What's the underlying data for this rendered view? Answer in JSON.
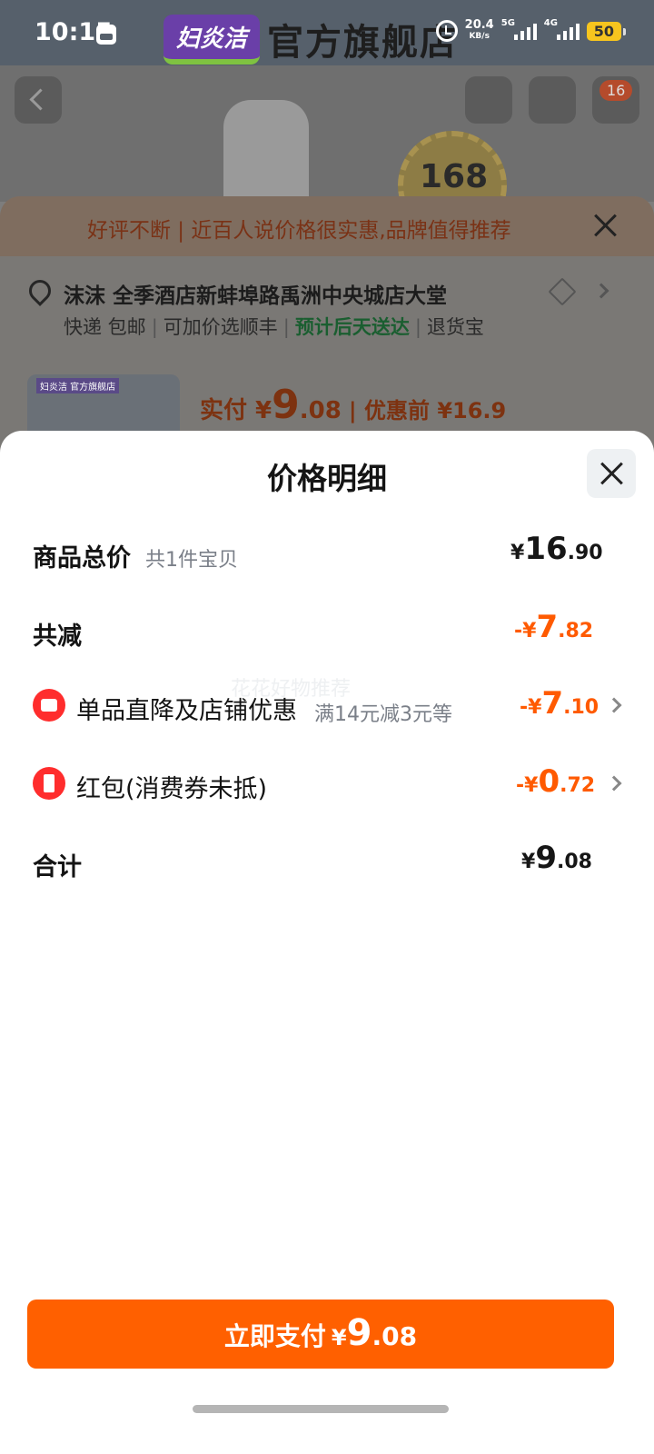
{
  "status_bar": {
    "time": "10:15",
    "net_speed_value": "20.4",
    "net_speed_unit": "KB/s",
    "sim1_label": "5G",
    "sim2_label": "4G",
    "battery": "50"
  },
  "brand_banner": {
    "logo_text": "妇炎洁",
    "store_name": "官方旗舰店"
  },
  "product_page": {
    "cart_badge": "16",
    "seal_text": "168",
    "review_text": "好评不断 | 近百人说价格很实惠,品牌值得推荐",
    "address": "沫沫 全季酒店新蚌埠路禹洲中央城店大堂",
    "delivery": {
      "express": "快递 包邮",
      "sf": "可加价选顺丰",
      "eta": "预计后天送达",
      "return": "退货宝"
    },
    "thumb_badge": "妇炎洁 官方旗舰店",
    "price": {
      "prefix": "实付 ¥",
      "int": "9",
      "dec": ".08",
      "original": "| 优惠前 ¥16.9"
    }
  },
  "modal": {
    "title": "价格明细",
    "watermark": "花花好物推荐",
    "rows": {
      "total": {
        "label": "商品总价",
        "sub": "共1件宝贝",
        "prefix": "¥",
        "int": "16",
        "dec": ".90"
      },
      "reduce": {
        "label": "共减",
        "prefix": "-¥",
        "int": "7",
        "dec": ".82"
      },
      "shop_discount": {
        "label": "单品直降及店铺优惠",
        "sub": "满14元减3元等",
        "prefix": "-¥",
        "int": "7",
        "dec": ".10"
      },
      "red_packet": {
        "label": "红包(消费券未抵)",
        "prefix": "-¥",
        "int": "0",
        "dec": ".72"
      },
      "sum": {
        "label": "合计",
        "prefix": "¥",
        "int": "9",
        "dec": ".08"
      }
    },
    "pay_button": {
      "label": "立即支付",
      "prefix": "¥",
      "int": "9",
      "dec": ".08"
    }
  },
  "colors": {
    "accent": "#ff6000",
    "discount": "#ff5a00",
    "icon_red": "#ff2d2d"
  }
}
